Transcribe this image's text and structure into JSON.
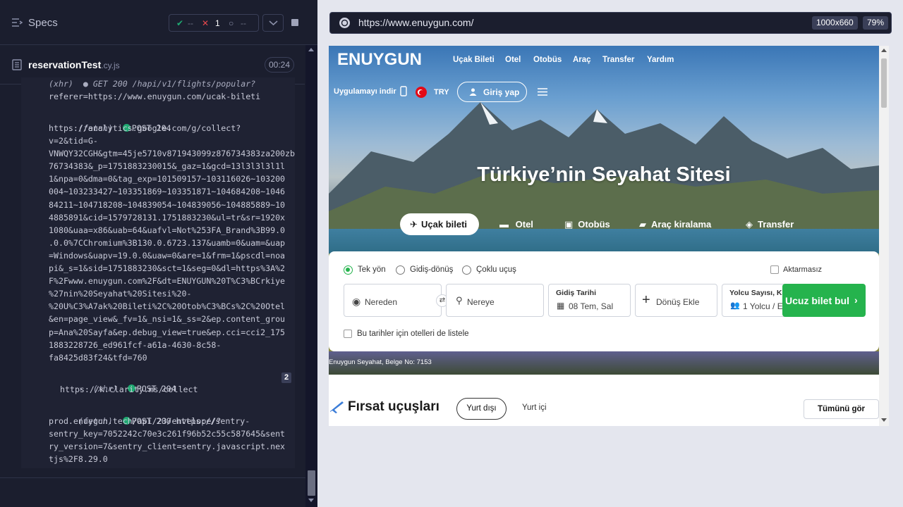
{
  "runner": {
    "specs_label": "Specs",
    "stats": {
      "passed": "--",
      "failed": "1",
      "pending": "--"
    },
    "test": {
      "name": "reservationTest",
      "ext": ".cy.js",
      "duration": "00:24"
    },
    "log": [
      "(xhr)  ● GET 200 /hapi/v1/flights/popular?",
      "referer=https://www.enuygun.com/ucak-bileti"
    ],
    "log_fetch1_tag": "(fetch)",
    "log_fetch1_status": "POST 204",
    "log_fetch1_url": "https://analytics.google.com/g/collect?\nv=2&tid=G-\nVNWQY32CGH&gtm=45je5710v871943099z876734383za200zb\n76734383&_p=1751883230015&_gaz=1&gcd=13l3l3l3l1l\n1&npa=0&dma=0&tag_exp=101509157~103116026~103200\n004~103233427~103351869~103351871~104684208~1046\n84211~104718208~104839054~104839056~104885889~10\n4885891&cid=1579728131.1751883230&ul=tr&sr=1920x\n1080&uaa=x86&uab=64&uafvl=Not%253FA_Brand%3B99.0\n.0.0%7CChromium%3B130.0.6723.137&uamb=0&uam=&uap\n=Windows&uapv=19.0.0&uaw=0&are=1&frm=1&pscdl=noa\npi&_s=1&sid=1751883230&sct=1&seg=0&dl=https%3A%2\nF%2Fwww.enuygun.com%2F&dt=ENUYGUN%20T%C3%BCrkiye\n%27nin%20Seyahat%20Sitesi%20-\n%20U%C3%A7ak%20Bileti%2C%20Otob%C3%BCs%2C%20Otel\n&en=page_view&_fv=1&_nsi=1&_ss=2&ep.content_grou\np=Ana%20Sayfa&ep.debug_view=true&ep.cci=cci2_175\n1883228726_ed961fcf-a61a-4630-8c58-\nfa8425d83f24&tfd=760",
    "log_xhr_tag": "(xhr)",
    "log_xhr_status": "POST 204",
    "log_xhr_url": "https://k.clarity.ms/collect",
    "log_xhr_count": "2",
    "log_fetch2_tag": "(fetch)",
    "log_fetch2_status": "POST 200",
    "log_fetch2_url_first": "https://sentry-",
    "log_fetch2_url": "prod.enuygun.tech/api/23/envelope/?\nsentry_key=7052242c70e3c261f96b52c55c587645&sent\nry_version=7&sentry_client=sentry.javascript.nex\ntjs%2F8.29.0",
    "url": "https://www.enuygun.com/",
    "viewport": "1000x660",
    "zoom": "79%"
  },
  "site": {
    "logo": "ENUYGUN",
    "nav": [
      "Uçak Bileti",
      "Otel",
      "Otobüs",
      "Araç",
      "Transfer",
      "Yardım"
    ],
    "app_download": "Uygulamayı indir",
    "currency": "TRY",
    "login": "Giriş yap",
    "headline": "Türkiye’nin Seyahat Sitesi",
    "tabs": [
      "Uçak bileti",
      "Otel",
      "Otobüs",
      "Araç kiralama",
      "Transfer"
    ],
    "trip_types": [
      "Tek yön",
      "Gidiş-dönüş",
      "Çoklu uçuş"
    ],
    "nonstop": "Aktarmasız",
    "from_placeholder": "Nereden",
    "to_placeholder": "Nereye",
    "depart_label": "Gidiş Tarihi",
    "depart_value": "08 Tem, Sal",
    "return_label": "Dönüş Ekle",
    "pax_label": "Yolcu Sayısı, Ka...",
    "pax_value": "1 Yolcu / E",
    "search_btn": "Ucuz bilet bul",
    "hotels_checkbox": "Bu tarihler için otelleri de listele",
    "credit": "Enuygun Seyahat, Belge No: 7153",
    "deals_title": "Fırsat uçuşları",
    "deal_abroad": "Yurt dışı",
    "deal_domestic": "Yurt içi",
    "see_all": "Tümünü gör"
  },
  "colors": {
    "runner_bg": "#1b1e2e",
    "pass": "#1fa971",
    "fail": "#e5484d",
    "search_btn": "#25b34d"
  }
}
